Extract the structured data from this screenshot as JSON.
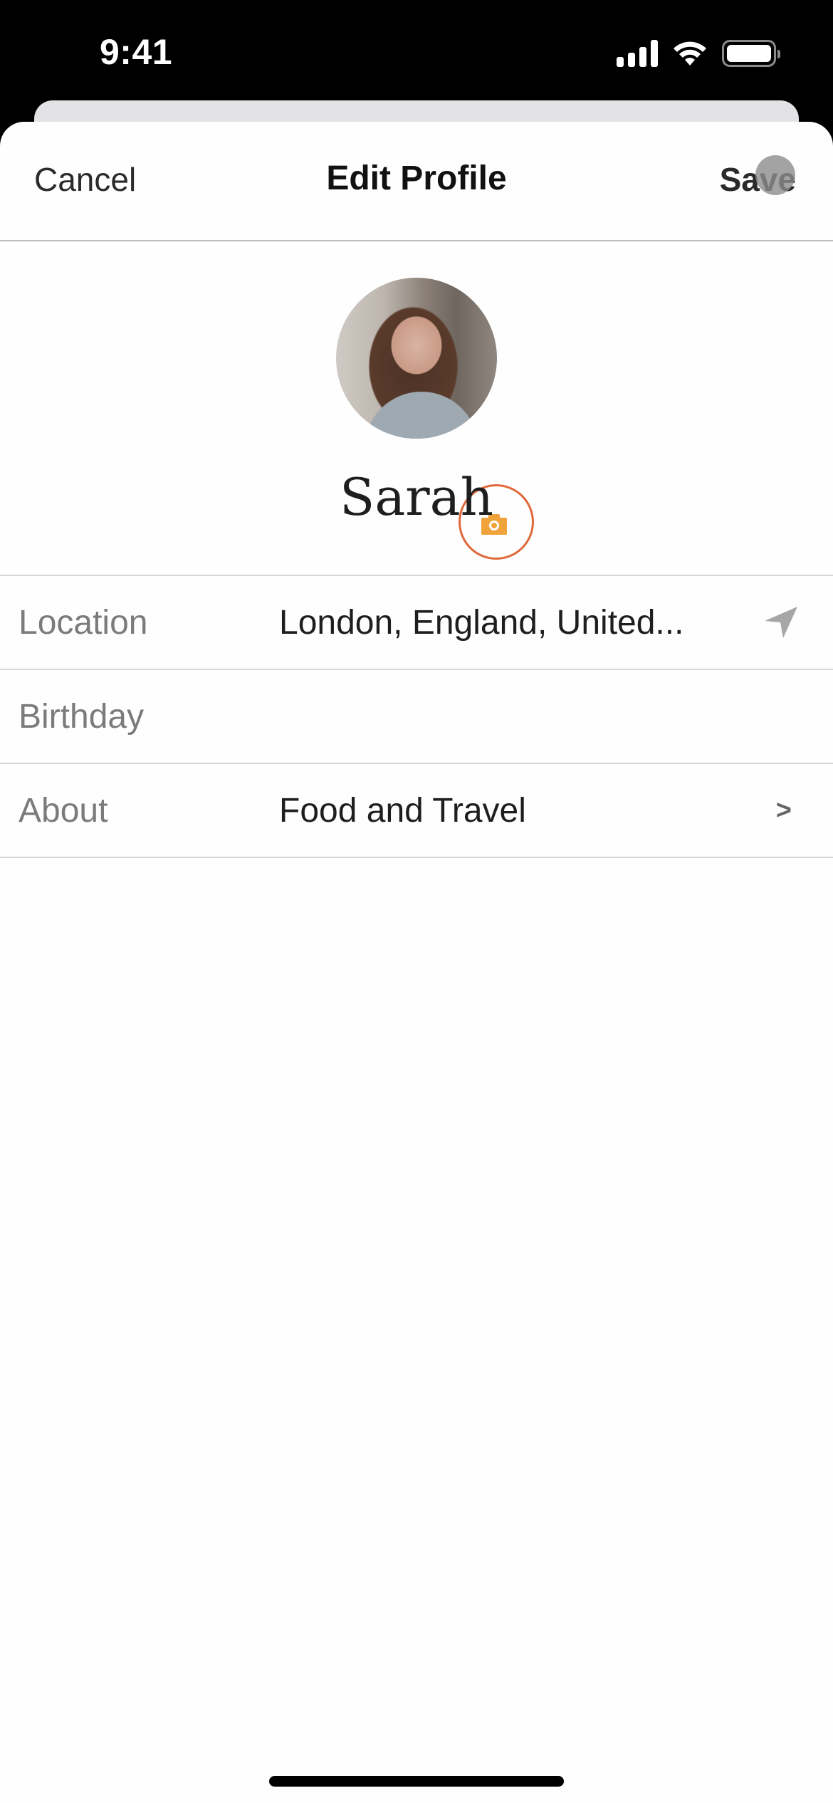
{
  "status_bar": {
    "time": "9:41",
    "icons": [
      "cellular-signal-icon",
      "wifi-icon",
      "battery-icon"
    ]
  },
  "nav": {
    "cancel_label": "Cancel",
    "title": "Edit Profile",
    "save_label": "Save"
  },
  "profile": {
    "name": "Sarah",
    "avatar_icon": "profile-photo",
    "camera_icon": "camera-icon"
  },
  "fields": [
    {
      "label": "Location",
      "value": "London, England, United...",
      "icon": "location-arrow-icon"
    },
    {
      "label": "Birthday",
      "value": ""
    },
    {
      "label": "About",
      "value": "Food and Travel",
      "icon": "chevron-right-icon",
      "glyph": ">"
    }
  ],
  "colors": {
    "accent_orange": "#e0683a",
    "camera_fill": "#f0a33a",
    "label_gray": "#7b7b7b",
    "text_dark": "#1e1e1e"
  }
}
